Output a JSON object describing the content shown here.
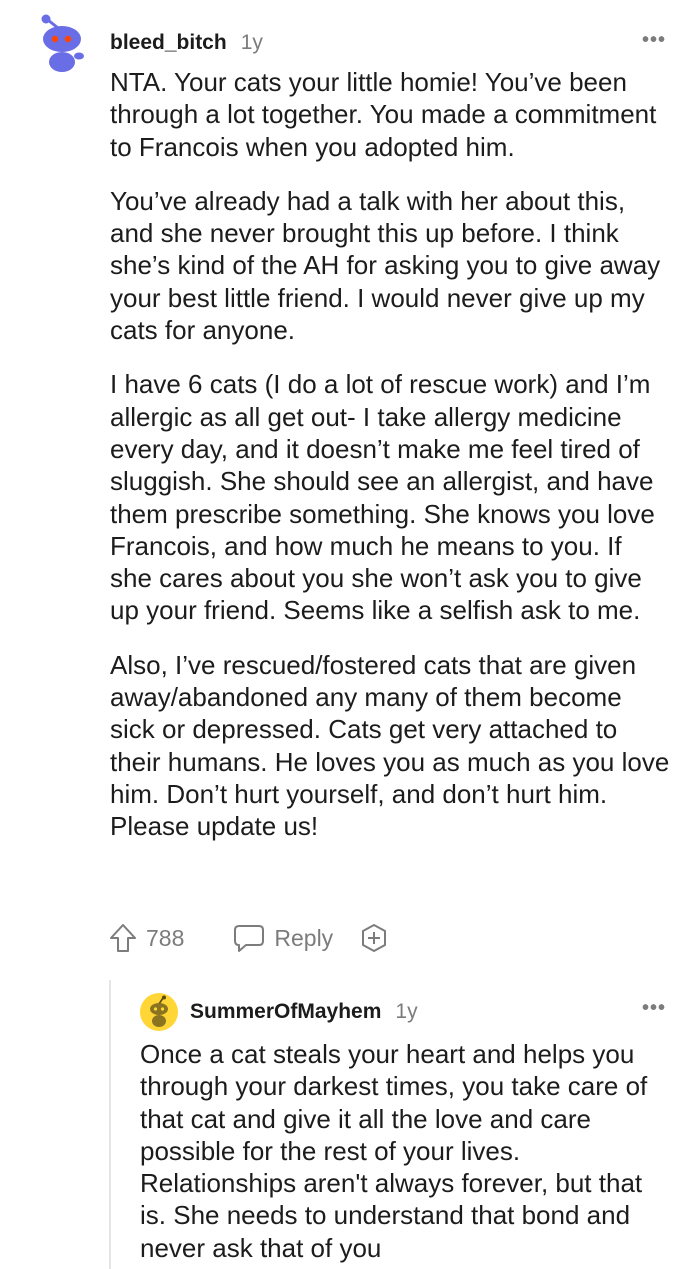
{
  "comment": {
    "username": "bleed_bitch",
    "age": "1y",
    "more_label": "•••",
    "avatar_icon": "snoo-avatar-icon",
    "paragraphs": [
      "NTA. Your cats your little homie! You’ve been through a lot together. You made a commitment to Francois when you adopted him.",
      "You’ve already had a talk with her about this, and she never brought this up before. I think she’s kind of the AH for asking you to give away your best little friend. I would never give up my cats for anyone.",
      "I have 6 cats (I do a lot of rescue work) and I’m allergic as all get out- I take allergy medicine every day, and it doesn’t make me feel tired of sluggish. She should see an allergist, and have them prescribe something. She knows you love Francois, and how much he means to you. If she cares about you she won’t ask you to give up your friend. Seems like a selfish ask to me.",
      "Also, I’ve rescued/fostered cats that are given away/abandoned any many of them become sick or depressed. Cats get very attached to their humans. He loves you as much as you love him. Don’t hurt yourself, and don’t hurt him. Please update us!"
    ],
    "actions": {
      "upvote_count": "788",
      "upvote_icon": "upvote-arrow-icon",
      "reply_label": "Reply",
      "reply_icon": "speech-bubble-icon",
      "award_icon": "plus-circle-icon"
    }
  },
  "reply": {
    "username": "SummerOfMayhem",
    "age": "1y",
    "more_label": "•••",
    "avatar_icon": "yellow-snoo-avatar-icon",
    "text": "Once a cat steals your heart and helps you through your darkest times, you take care of that cat and give it all the love and care possible for the rest of your lives. Relationships aren't always forever, but that is. She needs to understand that bond and never ask that of you"
  },
  "colors": {
    "text": "#1c1c1c",
    "meta": "#7c7c7c",
    "avatar_blue": "#6a6ee6",
    "avatar_yellow": "#ffd635",
    "thread_line": "#e5e5e5"
  }
}
